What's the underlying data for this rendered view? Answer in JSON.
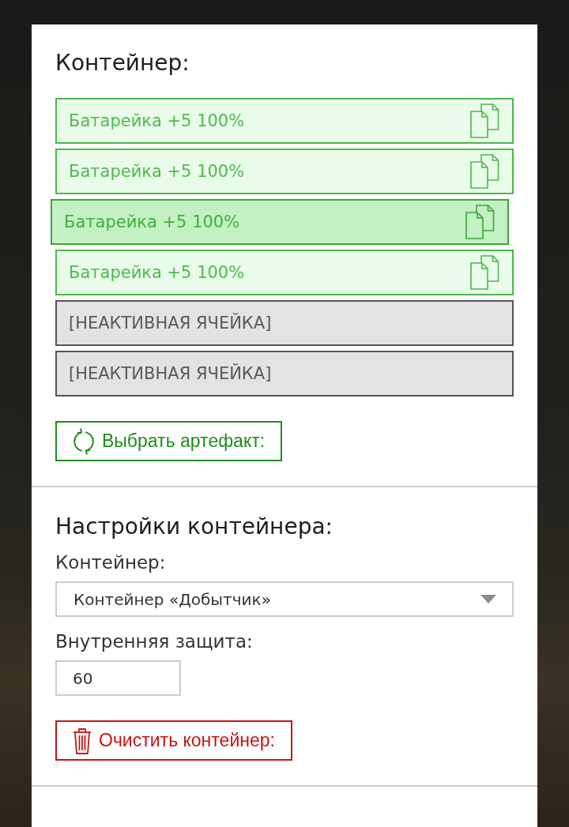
{
  "container": {
    "title": "Контейнер:",
    "slots": [
      {
        "kind": "item",
        "label": "Батарейка +5 100%",
        "dragging": false
      },
      {
        "kind": "item",
        "label": "Батарейка +5 100%",
        "dragging": false
      },
      {
        "kind": "item",
        "label": "Батарейка +5 100%",
        "dragging": true
      },
      {
        "kind": "item",
        "label": "Батарейка +5 100%",
        "dragging": false
      },
      {
        "kind": "inactive",
        "label": "[НЕАКТИВНАЯ ЯЧЕЙКА]"
      },
      {
        "kind": "inactive",
        "label": "[НЕАКТИВНАЯ ЯЧЕЙКА]"
      }
    ],
    "select_button": {
      "label": "Выбрать артефакт:"
    }
  },
  "settings": {
    "title": "Настройки контейнера:",
    "fields": [
      {
        "kind": "select",
        "label": "Контейнер:",
        "value": "Контейнер «Добытчик»"
      },
      {
        "kind": "number",
        "label": "Внутренняя защита:",
        "value": "60"
      }
    ],
    "clear_button": {
      "label": "Очистить контейнер:"
    }
  }
}
